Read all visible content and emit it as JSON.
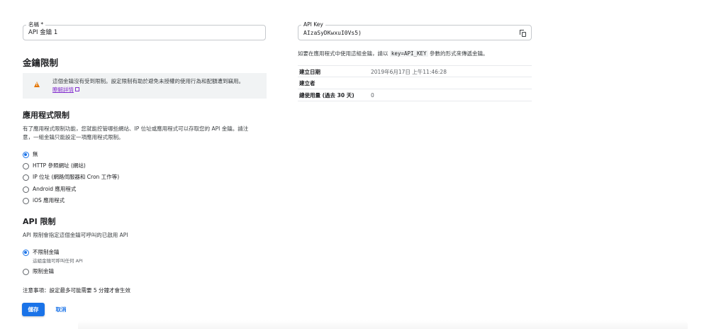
{
  "name_field": {
    "label": "名稱 *",
    "value": "API 金鑰 1"
  },
  "key_restrictions": {
    "title": "金鑰限制",
    "warning_text": "這個金鑰沒有受到限制。設定限制有助於避免未授權的使用行為和配額遭到竊用。",
    "learn_more": "瞭解詳情"
  },
  "app_restrictions": {
    "title": "應用程式限制",
    "description_line1": "有了應用程式限制功能，您就能控管哪些網站、IP 位址或應用程式可以存取您的 API 金鑰。請注",
    "description_line2": "意，一組金鑰只能設定一項應用程式限制。",
    "options": [
      {
        "label": "無",
        "checked": true
      },
      {
        "label": "HTTP 參照網址 (網站)",
        "checked": false
      },
      {
        "label": "IP 位址 (網路伺服器和 Cron 工作等)",
        "checked": false
      },
      {
        "label": "Android 應用程式",
        "checked": false
      },
      {
        "label": "iOS 應用程式",
        "checked": false
      }
    ]
  },
  "api_restrictions": {
    "title": "API 限制",
    "description": "API 限制會指定這個金鑰可呼叫的已啟用 API",
    "options": [
      {
        "label": "不限制金鑰",
        "hint": "這組金鑰可呼叫任何 API",
        "checked": true
      },
      {
        "label": "限制金鑰",
        "hint": "",
        "checked": false
      }
    ]
  },
  "note": "注意事項：設定最多可能需要 5 分鐘才會生效",
  "buttons": {
    "save": "儲存",
    "cancel": "取消"
  },
  "api_key_field": {
    "label": "API Key",
    "value": "AIzaSyDKwxuI0Vs5)"
  },
  "info": {
    "prefix": "如要在應用程式中使用這組金鑰，請以",
    "param": "key=API_KEY",
    "suffix": "參數的形式來傳遞金鑰。"
  },
  "meta": [
    {
      "key": "建立日期",
      "value": "2019年6月17日 上午11:46:28"
    },
    {
      "key": "建立者",
      "value": ""
    },
    {
      "key": "總使用量 (過去 30 天)",
      "value": "0"
    }
  ],
  "colors": {
    "primary": "#1a73e8",
    "warning": "#e37400",
    "link_visited": "#8430ce"
  }
}
